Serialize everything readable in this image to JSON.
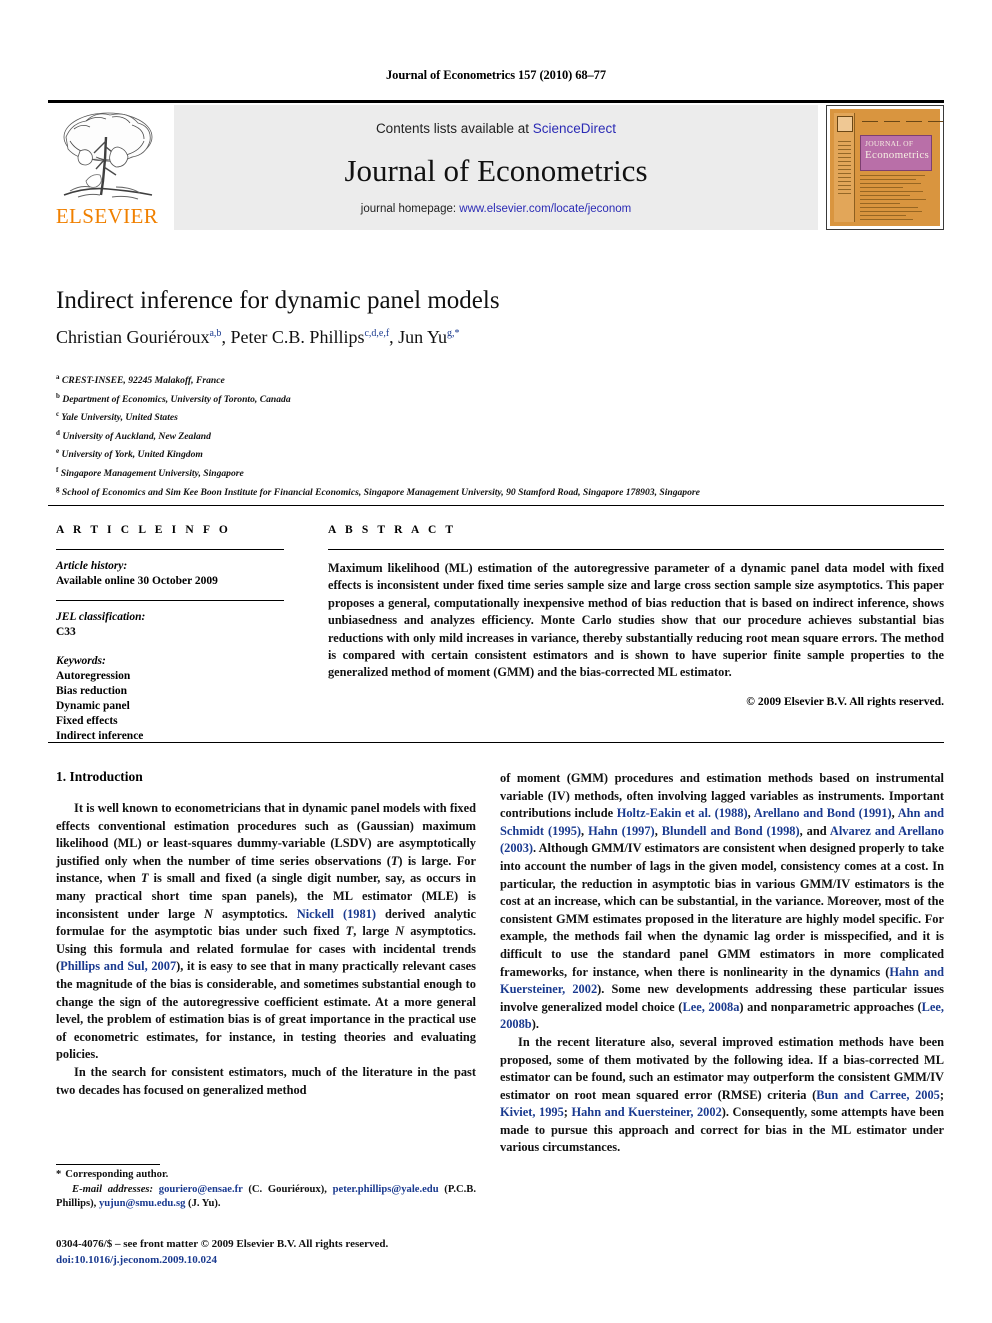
{
  "running_head": "Journal of Econometrics 157 (2010) 68–77",
  "masthead": {
    "contents_prefix": "Contents lists available at ",
    "sciencedirect": "ScienceDirect",
    "journal_title": "Journal of Econometrics",
    "homepage_prefix": "journal homepage: ",
    "homepage_url": "www.elsevier.com/locate/jeconom",
    "publisher": "ELSEVIER",
    "link_color": "#2b2bb5",
    "elsevier_orange": "#F08000",
    "banner_bg": "#ececec"
  },
  "cover": {
    "title_line1": "JOURNAL OF",
    "title_line2": "Econometrics",
    "bg_color": "#D9953F",
    "title_box_color": "#B96FA8"
  },
  "article": {
    "title": "Indirect inference for dynamic panel models",
    "authors": [
      {
        "name": "Christian Gouriéroux",
        "sup": "a,b"
      },
      {
        "name": "Peter C.B. Phillips",
        "sup": "c,d,e,f"
      },
      {
        "name": "Jun Yu",
        "sup": "g,*"
      }
    ],
    "affiliations": [
      {
        "mark": "a",
        "text": "CREST-INSEE, 92245 Malakoff, France"
      },
      {
        "mark": "b",
        "text": "Department of Economics, University of Toronto, Canada"
      },
      {
        "mark": "c",
        "text": "Yale University, United States"
      },
      {
        "mark": "d",
        "text": "University of Auckland, New Zealand"
      },
      {
        "mark": "e",
        "text": "University of York, United Kingdom"
      },
      {
        "mark": "f",
        "text": "Singapore Management University, Singapore"
      },
      {
        "mark": "g",
        "text": "School of Economics and Sim Kee Boon Institute for Financial Economics, Singapore Management University, 90 Stamford Road, Singapore 178903, Singapore"
      }
    ]
  },
  "info": {
    "heading": "A R T I C L E    I N F O",
    "history_label": "Article history:",
    "history_value": "Available online 30 October 2009",
    "jel_label": "JEL classification:",
    "jel_value": "C33",
    "keywords_label": "Keywords:",
    "keywords": [
      "Autoregression",
      "Bias reduction",
      "Dynamic panel",
      "Fixed effects",
      "Indirect inference"
    ]
  },
  "abstract": {
    "heading": "A B S T R A C T",
    "text": "Maximum likelihood (ML) estimation of the autoregressive parameter of a dynamic panel data model with fixed effects is inconsistent under fixed time series sample size and large cross section sample size asymptotics. This paper proposes a general, computationally inexpensive method of bias reduction that is based on indirect inference, shows unbiasedness and analyzes efficiency. Monte Carlo studies show that our procedure achieves substantial bias reductions with only mild increases in variance, thereby substantially reducing root mean square errors. The method is compared with certain consistent estimators and is shown to have superior finite sample properties to the generalized method of moment (GMM) and the bias-corrected ML estimator.",
    "copyright": "© 2009 Elsevier B.V. All rights reserved."
  },
  "body": {
    "section_title": "1. Introduction",
    "left_para1_a": "It is well known to econometricians that in dynamic panel models with fixed effects conventional estimation procedures such as (Gaussian) maximum likelihood (ML) or least-squares dummy-variable (LSDV) are asymptotically justified only when the number of time series observations (",
    "left_para1_T1": "T",
    "left_para1_b": ") is large. For instance, when ",
    "left_para1_T2": "T",
    "left_para1_c": " is small and fixed (a single digit number, say, as occurs in many practical short time span panels), the ML estimator (MLE) is inconsistent under large ",
    "left_para1_N1": "N",
    "left_para1_d": " asymptotics. ",
    "left_cite1": "Nickell (1981)",
    "left_para1_e": " derived analytic formulae for the asymptotic bias under such fixed ",
    "left_para1_T3": "T",
    "left_para1_f": ", large ",
    "left_para1_N2": "N",
    "left_para1_g": " asymptotics. Using this formula and related formulae for cases with incidental trends (",
    "left_cite2": "Phillips and Sul, 2007",
    "left_para1_h": "), it is easy to see that in many practically relevant cases the magnitude of the bias is considerable, and sometimes substantial enough to change the sign of the autoregressive coefficient estimate. At a more general level, the problem of estimation bias is of great importance in the practical use of econometric estimates, for instance, in testing theories and evaluating policies.",
    "left_para2": "In the search for consistent estimators, much of the literature in the past two decades has focused on generalized method",
    "right_para1_a": "of moment (GMM) procedures and estimation methods based on instrumental variable (IV) methods, often involving lagged variables as instruments. Important contributions include ",
    "right_cite_1": "Holtz-Eakin et al. (1988)",
    "right_sep_1": ", ",
    "right_cite_2": "Arellano and Bond (1991)",
    "right_sep_2": ", ",
    "right_cite_3": "Ahn and Schmidt (1995)",
    "right_sep_3": ", ",
    "right_cite_4": "Hahn (1997)",
    "right_sep_4": ", ",
    "right_cite_5": "Blundell and Bond (1998)",
    "right_sep_5": ", and ",
    "right_cite_6": "Alvarez and Arellano (2003)",
    "right_para1_b": ". Although GMM/IV estimators are consistent when designed properly to take into account the number of lags in the given model, consistency comes at a cost. In particular, the reduction in asymptotic bias in various GMM/IV estimators is the cost at an increase, which can be substantial, in the variance. Moreover, most of the consistent GMM estimates proposed in the literature are highly model specific. For example, the methods fail when the dynamic lag order is misspecified, and it is difficult to use the standard panel GMM estimators in more complicated frameworks, for instance, when there is nonlinearity in the dynamics (",
    "right_cite_7": "Hahn and Kuersteiner, 2002",
    "right_para1_c": "). Some new developments addressing these particular issues involve generalized model choice (",
    "right_cite_8": "Lee, 2008a",
    "right_para1_d": ") and nonparametric approaches (",
    "right_cite_9": "Lee, 2008b",
    "right_para1_e": ").",
    "right_para2_a": "In the recent literature also, several improved estimation methods have been proposed, some of them motivated by the following idea. If a bias-corrected ML estimator can be found, such an estimator may outperform the consistent GMM/IV estimator on root mean squared error (RMSE) criteria (",
    "right_cite_10": "Bun and Carree, 2005",
    "right_sep_6": "; ",
    "right_cite_11": "Kiviet, 1995",
    "right_sep_7": "; ",
    "right_cite_12": "Hahn and Kuersteiner, 2002",
    "right_para2_b": "). Consequently, some attempts have been made to pursue this approach and correct for bias in the ML estimator under various circumstances.",
    "citation_color": "#1a3a8f"
  },
  "footnotes": {
    "star": "*",
    "corresponding": "Corresponding author.",
    "email_label": "E-mail addresses:",
    "email1": "gouriero@ensae.fr",
    "email1_who": " (C. Gouriéroux), ",
    "email2": "peter.phillips@yale.edu",
    "email2_who": " (P.C.B. Phillips), ",
    "email3": "yujun@smu.edu.sg",
    "email3_who": " (J. Yu)."
  },
  "footer": {
    "issn_line": "0304-4076/$ – see front matter © 2009 Elsevier B.V. All rights reserved.",
    "doi": "doi:10.1016/j.jeconom.2009.10.024"
  }
}
